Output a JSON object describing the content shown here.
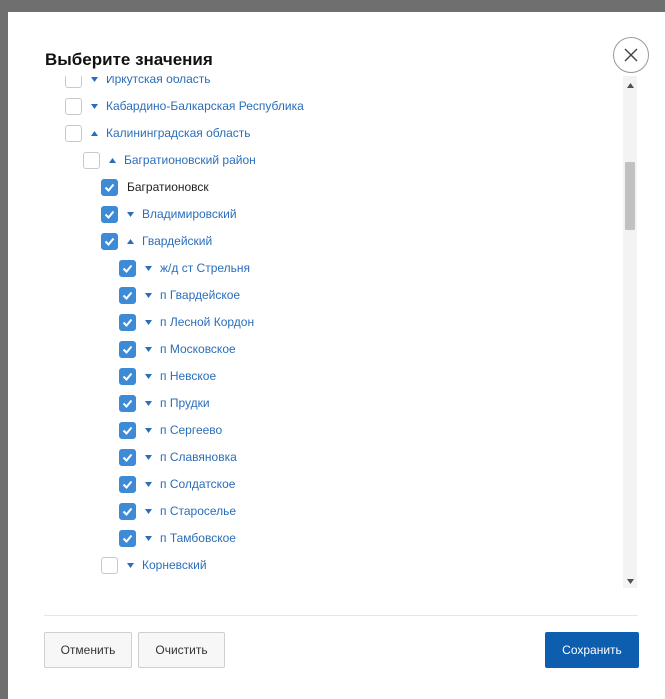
{
  "dialog": {
    "title": "Выберите значения"
  },
  "colors": {
    "link": "#2a6ebb",
    "checked": "#3d8ad6",
    "primary_button": "#0d5eae"
  },
  "tree": {
    "items": [
      {
        "label": "Иркутская область",
        "checked": false,
        "expand": "collapsed",
        "level": 0
      },
      {
        "label": "Кабардино-Балкарская Республика",
        "checked": false,
        "expand": "collapsed",
        "level": 0
      },
      {
        "label": "Калининградская область",
        "checked": false,
        "expand": "expanded",
        "level": 0
      },
      {
        "label": "Багратионовский район",
        "checked": false,
        "expand": "expanded",
        "level": 1
      },
      {
        "label": "Багратионовск",
        "checked": true,
        "expand": "none",
        "level": 2
      },
      {
        "label": "Владимировский",
        "checked": true,
        "expand": "collapsed",
        "level": 2
      },
      {
        "label": "Гвардейский",
        "checked": true,
        "expand": "expanded",
        "level": 2
      },
      {
        "label": "ж/д ст Стрельня",
        "checked": true,
        "expand": "collapsed",
        "level": 3
      },
      {
        "label": "п Гвардейское",
        "checked": true,
        "expand": "collapsed",
        "level": 3
      },
      {
        "label": "п Лесной Кордон",
        "checked": true,
        "expand": "collapsed",
        "level": 3
      },
      {
        "label": "п Московское",
        "checked": true,
        "expand": "collapsed",
        "level": 3
      },
      {
        "label": "п Невское",
        "checked": true,
        "expand": "collapsed",
        "level": 3
      },
      {
        "label": "п Прудки",
        "checked": true,
        "expand": "collapsed",
        "level": 3
      },
      {
        "label": "п Сергеево",
        "checked": true,
        "expand": "collapsed",
        "level": 3
      },
      {
        "label": "п Славяновка",
        "checked": true,
        "expand": "collapsed",
        "level": 3
      },
      {
        "label": "п Солдатское",
        "checked": true,
        "expand": "collapsed",
        "level": 3
      },
      {
        "label": "п Староселье",
        "checked": true,
        "expand": "collapsed",
        "level": 3
      },
      {
        "label": "п Тамбовское",
        "checked": true,
        "expand": "collapsed",
        "level": 3
      },
      {
        "label": "Корневский",
        "checked": false,
        "expand": "collapsed",
        "level": 2
      }
    ]
  },
  "footer": {
    "cancel_label": "Отменить",
    "clear_label": "Очистить",
    "save_label": "Сохранить"
  }
}
